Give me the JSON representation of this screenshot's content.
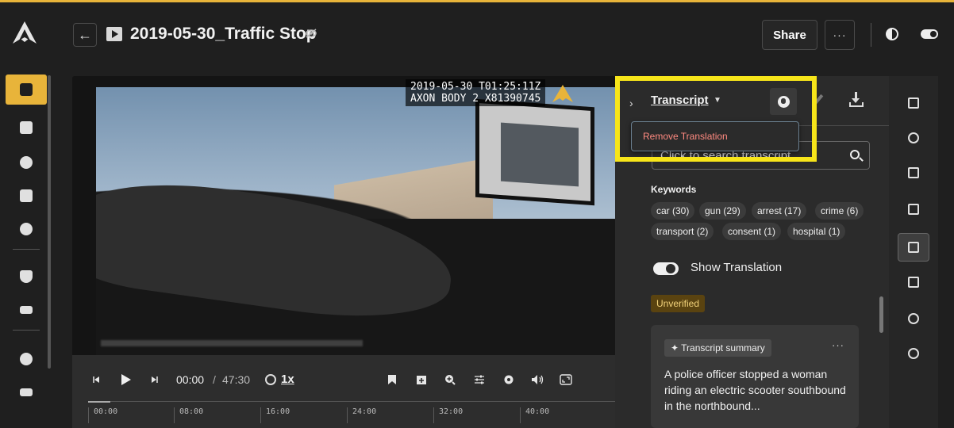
{
  "header": {
    "title": "2019-05-30_Traffic Stop",
    "share_label": "Share",
    "more_label": "···"
  },
  "video": {
    "timestamp": "2019-05-30 T01:25:11Z",
    "device": "AXON BODY 2 X81390745"
  },
  "player": {
    "current_time": "00:00",
    "separator": "/",
    "total_time": "47:30",
    "speed": "1x",
    "ruler_ticks": [
      "00:00",
      "08:00",
      "16:00",
      "24:00",
      "32:00",
      "40:00"
    ]
  },
  "transcript": {
    "tab_label": "Transcript",
    "dropdown_item": "Remove Translation",
    "search_placeholder": "Click to search transcript",
    "keywords_title": "Keywords",
    "keywords": [
      "car (30)",
      "gun (29)",
      "arrest (17)",
      "crime (6)",
      "transport (2)",
      "consent (1)",
      "hospital (1)"
    ],
    "show_translation_label": "Show Translation",
    "unverified_label": "Unverified",
    "summary_label": "Transcript summary",
    "summary_more": "···",
    "summary_text": "A police officer stopped a woman riding an electric scooter southbound in the northbound..."
  },
  "colors": {
    "accent": "#e8b43a",
    "highlight": "#f7e51a",
    "danger_text": "#ff8a80"
  }
}
